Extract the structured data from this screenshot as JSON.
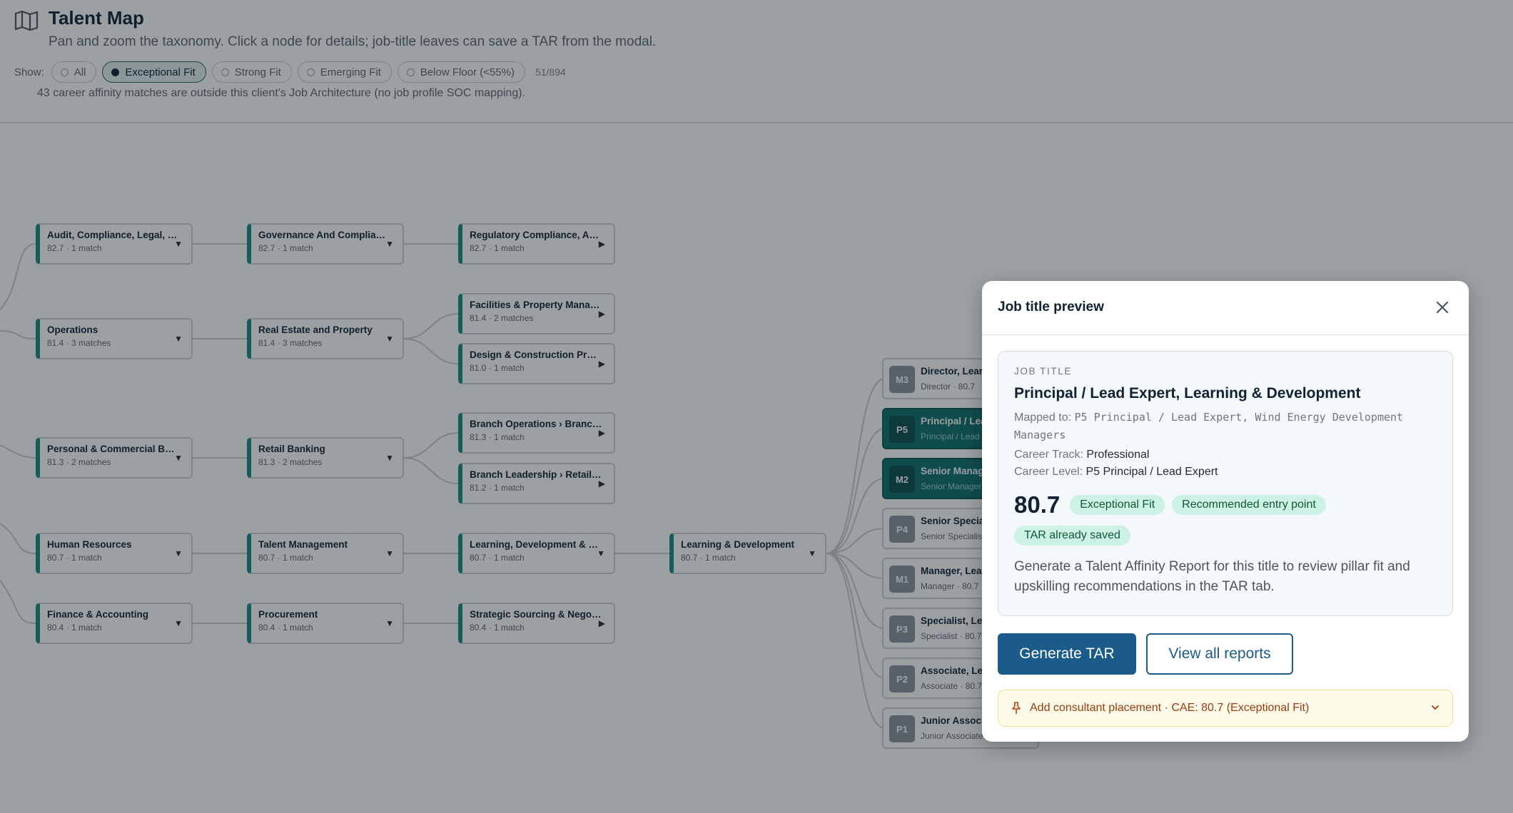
{
  "header": {
    "title": "Talent Map",
    "subtitle": "Pan and zoom the taxonomy. Click a node for details; job-title leaves can save a TAR from the modal.",
    "show_label": "Show:",
    "filters": [
      "All",
      "Exceptional Fit",
      "Strong Fit",
      "Emerging Fit",
      "Below Floor (<55%)"
    ],
    "active_filter": "Exceptional Fit",
    "count": "51/894",
    "notice": "43 career affinity matches are outside this client's Job Architecture (no job profile SOC mapping)."
  },
  "tree": {
    "col1": [
      {
        "label": "Audit, Compliance, Legal, R...",
        "meta": "82.7 · 1 match"
      },
      {
        "label": "Operations",
        "meta": "81.4 · 3 matches"
      },
      {
        "label": "Personal & Commercial Banki...",
        "meta": "81.3 · 2 matches"
      },
      {
        "label": "Human Resources",
        "meta": "80.7 · 1 match"
      },
      {
        "label": "Finance & Accounting",
        "meta": "80.4 · 1 match"
      }
    ],
    "col2": [
      {
        "label": "Governance And Compliance",
        "meta": "82.7 · 1 match"
      },
      {
        "label": "Real Estate and Property",
        "meta": "81.4 · 3 matches"
      },
      {
        "label": "Retail Banking",
        "meta": "81.3 · 2 matches"
      },
      {
        "label": "Talent Management",
        "meta": "80.7 · 1 match"
      },
      {
        "label": "Procurement",
        "meta": "80.4 · 1 match"
      }
    ],
    "col3": [
      {
        "label": "Regulatory Compliance, Advi...",
        "meta": "82.7 · 1 match"
      },
      {
        "label": "Facilities & Property Manag...",
        "meta": "81.4 · 2 matches"
      },
      {
        "label": "Design & Construction Proje...",
        "meta": "81.0 · 1 match"
      },
      {
        "label": "Branch Operations › Branch ...",
        "meta": "81.3 · 1 match"
      },
      {
        "label": "Branch Leadership › Retail ...",
        "meta": "81.2 · 1 match"
      },
      {
        "label": "Learning, Development & Per...",
        "meta": "80.7 · 1 match"
      },
      {
        "label": "Strategic Sourcing & Negoti...",
        "meta": "80.4 · 1 match"
      }
    ],
    "col4": [
      {
        "label": "Learning & Development",
        "meta": "80.7 · 1 match"
      }
    ],
    "jobs": [
      {
        "code": "M3",
        "label": "Director, Learn",
        "meta": "Director · 80.7"
      },
      {
        "code": "P5",
        "label": "Principal / Lea",
        "meta": "Principal / Lead"
      },
      {
        "code": "M2",
        "label": "Senior Manage",
        "meta": "Senior Manager"
      },
      {
        "code": "P4",
        "label": "Senior Special",
        "meta": "Senior Specialist"
      },
      {
        "code": "M1",
        "label": "Manager, Lear",
        "meta": "Manager · 80.7"
      },
      {
        "code": "P3",
        "label": "Specialist, Lea",
        "meta": "Specialist · 80.7"
      },
      {
        "code": "P2",
        "label": "Associate, Lea",
        "meta": "Associate · 80.7"
      },
      {
        "code": "P1",
        "label": "Junior Associa",
        "meta": "Junior Associate"
      }
    ]
  },
  "modal": {
    "title": "Job title preview",
    "eyebrow": "JOB TITLE",
    "job_title": "Principal / Lead Expert, Learning & Development",
    "mapped_prefix": "Mapped to:",
    "mapped_value": "P5 Principal / Lead Expert, Wind Energy Development Managers",
    "career_track_label": "Career Track:",
    "career_track": "Professional",
    "career_level_label": "Career Level:",
    "career_level": "P5 Principal / Lead Expert",
    "score": "80.7",
    "fit_badge": "Exceptional Fit",
    "entry_badge": "Recommended entry point",
    "saved_badge": "TAR already saved",
    "description": "Generate a Talent Affinity Report for this title to review pillar fit and upskilling recommendations in the TAR tab.",
    "primary_button": "Generate TAR",
    "secondary_button": "View all reports",
    "placement": "Add consultant placement · CAE: 80.7 (Exceptional Fit)"
  },
  "colors": {
    "accent": "#1a8a87",
    "primary": "#1a5b8a",
    "badge_bg": "#ccf2e3",
    "warning_bg": "#fffbeb",
    "warning_text": "#9a3b0c"
  }
}
